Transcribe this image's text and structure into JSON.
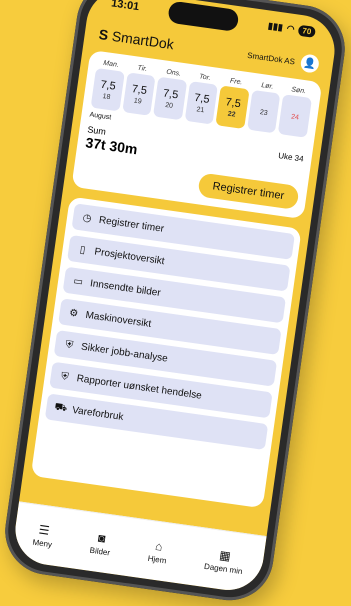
{
  "status": {
    "time": "13:01",
    "battery": "70"
  },
  "header": {
    "brand": "SmartDok",
    "company": "SmartDok AS"
  },
  "calendar": {
    "days": [
      {
        "name": "Man.",
        "hours": "7,5",
        "date": "18"
      },
      {
        "name": "Tir.",
        "hours": "7,5",
        "date": "19"
      },
      {
        "name": "Ons.",
        "hours": "7,5",
        "date": "20"
      },
      {
        "name": "Tor.",
        "hours": "7,5",
        "date": "21"
      },
      {
        "name": "Fre.",
        "hours": "7,5",
        "date": "22"
      },
      {
        "name": "Lør.",
        "hours": "",
        "date": "23"
      },
      {
        "name": "Søn.",
        "hours": "",
        "date": "24"
      }
    ],
    "month": "August",
    "sum_label": "Sum",
    "sum_value": "37t 30m",
    "week": "Uke 34",
    "register_button": "Registrer timer"
  },
  "menu": [
    {
      "icon": "clock-icon",
      "label": "Registrer timer"
    },
    {
      "icon": "clipboard-icon",
      "label": "Prosjektoversikt"
    },
    {
      "icon": "image-icon",
      "label": "Innsendte bilder"
    },
    {
      "icon": "excavator-icon",
      "label": "Maskinoversikt"
    },
    {
      "icon": "shield-icon",
      "label": "Sikker jobb-analyse"
    },
    {
      "icon": "shield-icon",
      "label": "Rapporter uønsket hendelse"
    },
    {
      "icon": "truck-icon",
      "label": "Vareforbruk"
    }
  ],
  "nav": {
    "menu": "Meny",
    "images": "Bilder",
    "home": "Hjem",
    "my_day": "Dagen min"
  }
}
